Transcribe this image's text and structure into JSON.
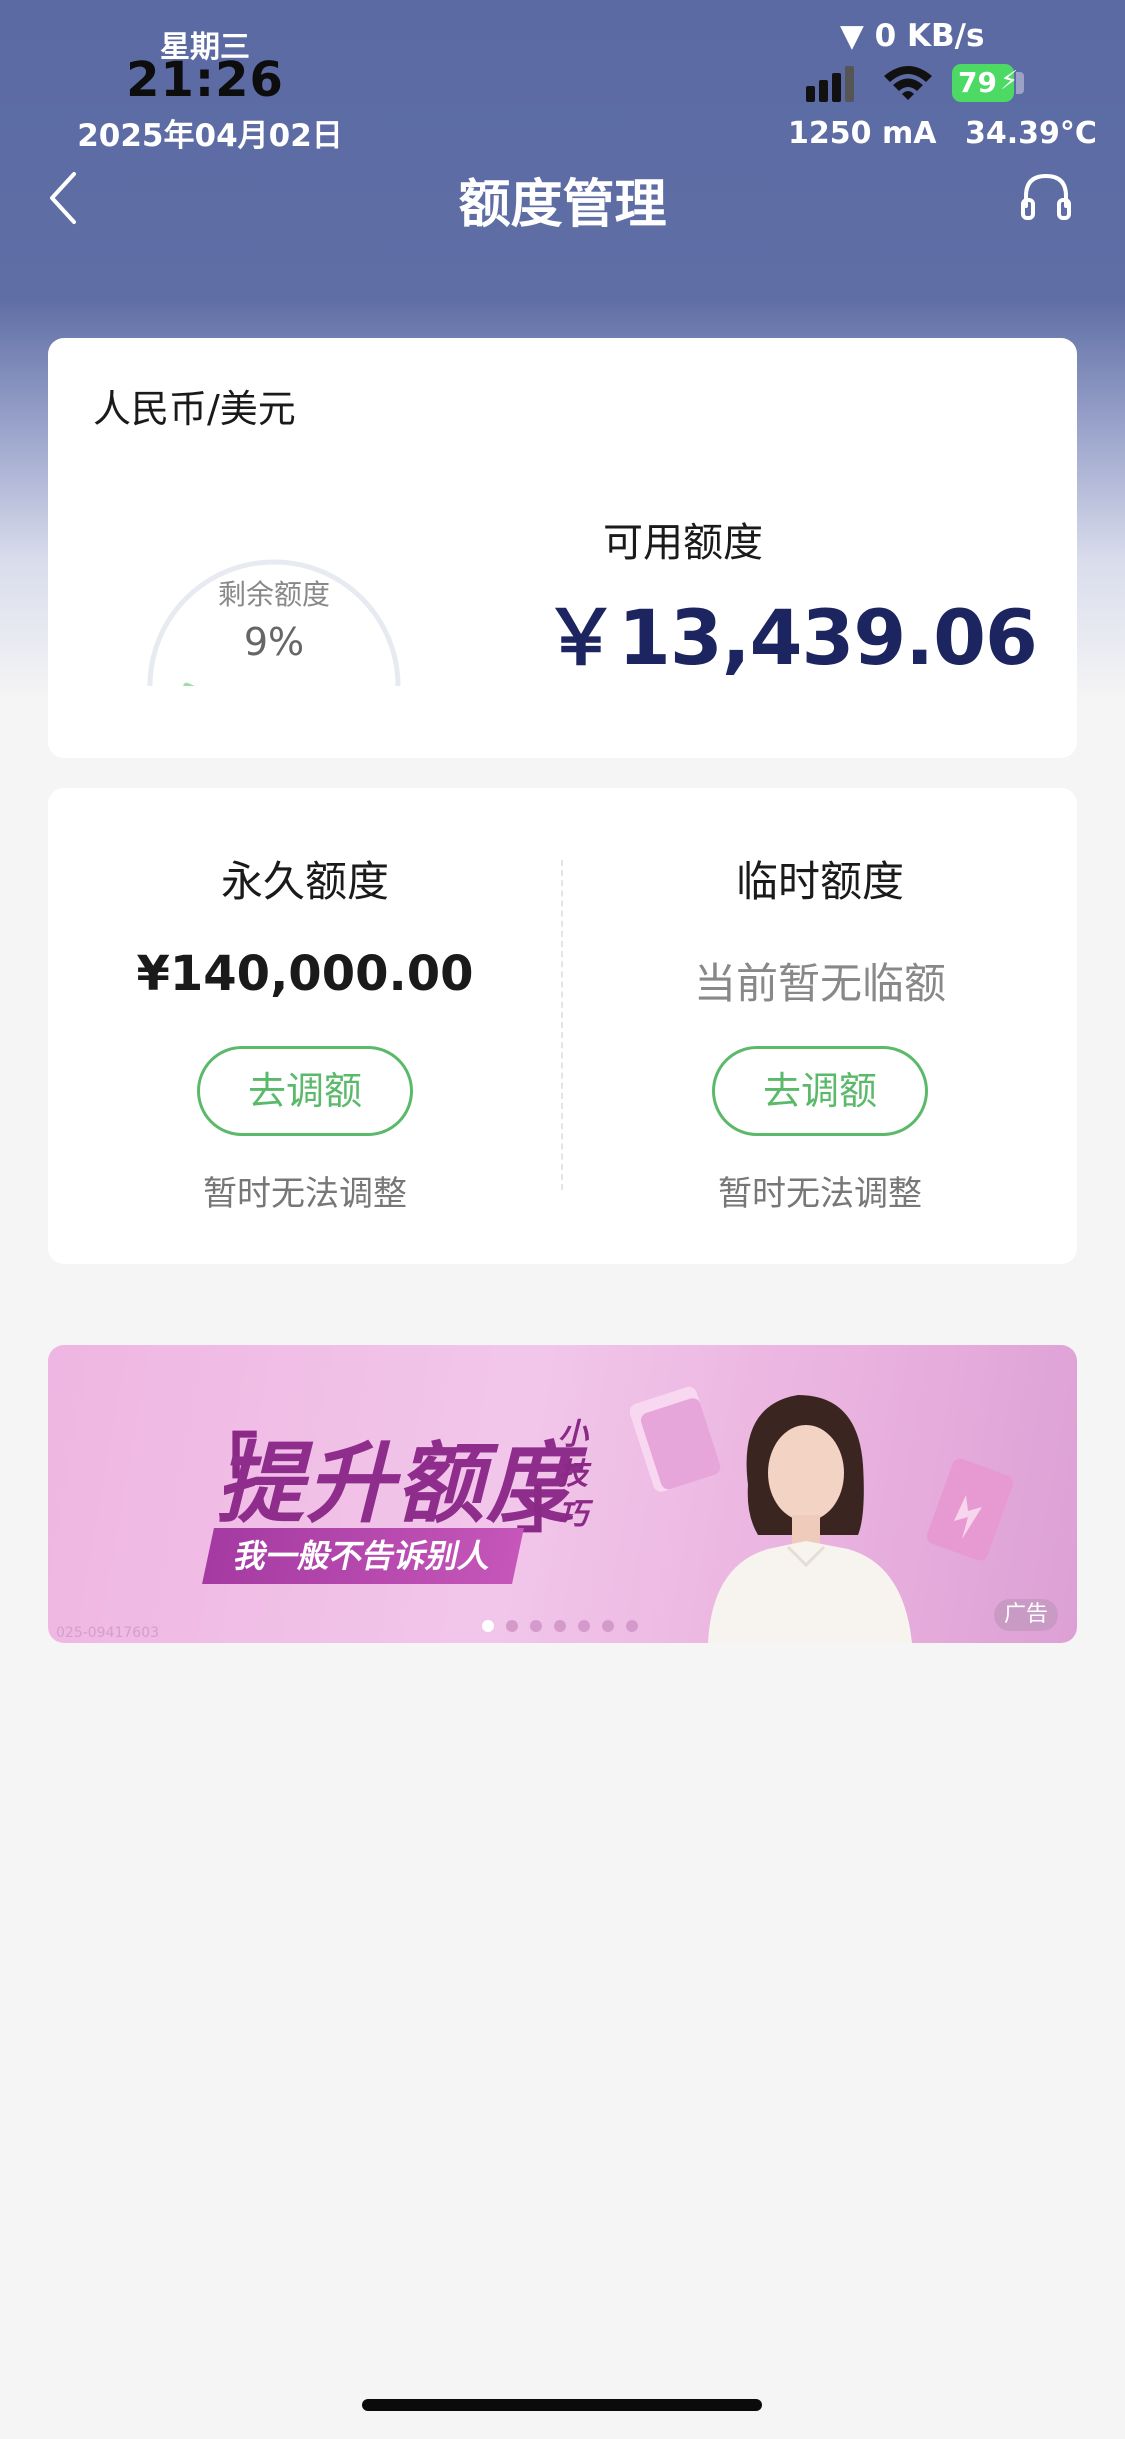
{
  "status_bar": {
    "weekday": "星期三",
    "time": "21:26",
    "date": "2025年04月02日",
    "network_speed": "▼ 0 KB/s",
    "battery_level": "79",
    "current": "1250 mA",
    "temperature": "34.39°C"
  },
  "nav": {
    "title": "额度管理",
    "back_icon": "chevron-left-icon",
    "support_icon": "headphones-icon"
  },
  "summary_card": {
    "currency": "人民币/美元",
    "gauge_label": "剩余额度",
    "gauge_value": "9%",
    "gauge_fraction": 0.09,
    "available_label": "可用额度",
    "available_amount": "￥13,439.06"
  },
  "limits_card": {
    "permanent": {
      "title": "永久额度",
      "value": "¥140,000.00",
      "button": "去调额",
      "note": "暂时无法调整"
    },
    "temporary": {
      "title": "临时额度",
      "value": "当前暂无临额",
      "button": "去调额",
      "note": "暂时无法调整"
    }
  },
  "banner": {
    "title": "提升额度",
    "quote_open": "「",
    "quote_close": "」",
    "small_text": "小技巧",
    "subtitle": "我一般不告诉别人",
    "ad_label": "广告",
    "code": "025-09417603",
    "slide_count": 7,
    "active_slide": 0
  },
  "colors": {
    "header_bg": "#5b6aa3",
    "accent_green": "#5bb96a",
    "amount_navy": "#1d2560",
    "banner_purple": "#8e2d8b"
  }
}
